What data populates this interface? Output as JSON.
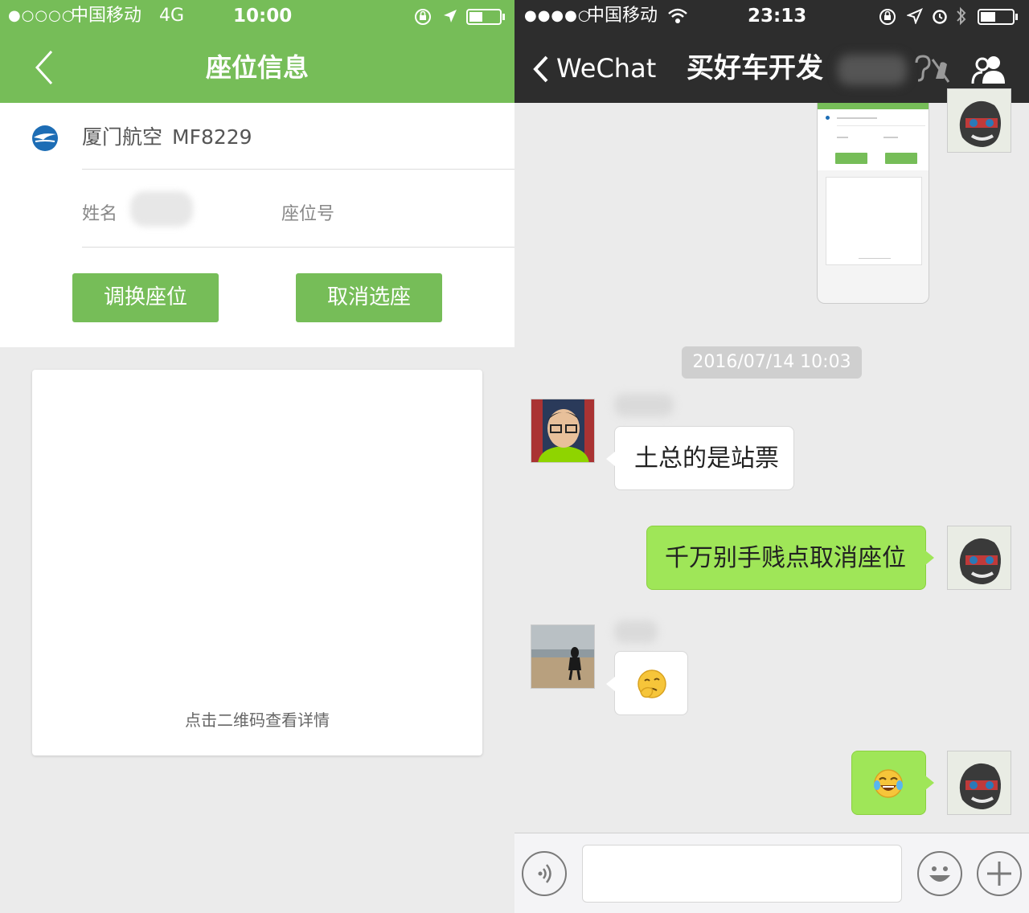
{
  "left": {
    "status": {
      "signal": "●○○○○",
      "carrier": "中国移动",
      "network": "4G",
      "time": "10:00"
    },
    "nav": {
      "title": "座位信息"
    },
    "flight": {
      "airline": "厦门航空",
      "number": "MF8229"
    },
    "labels": {
      "name": "姓名",
      "seat": "座位号"
    },
    "buttons": {
      "change_seat": "调换座位",
      "cancel_seat": "取消选座"
    },
    "qr": {
      "hint": "点击二维码查看详情"
    },
    "colors": {
      "accent": "#76bd58"
    }
  },
  "right": {
    "status": {
      "signal": "●●●●○",
      "carrier": "中国移动",
      "time": "23:13"
    },
    "nav": {
      "back_label": "WeChat",
      "title": "买好车开发"
    },
    "timestamp": "2016/07/14 10:03",
    "messages": [
      {
        "direction": "incoming",
        "text": "土总的是站票"
      },
      {
        "direction": "outgoing",
        "text": "千万别手贱点取消座位"
      },
      {
        "direction": "incoming",
        "emoji": "thinking-face"
      },
      {
        "direction": "outgoing",
        "emoji": "tears-of-joy-face"
      }
    ],
    "icons": [
      "voice-icon",
      "emoji-icon",
      "plus-icon",
      "group-members-icon",
      "mute-icon"
    ],
    "colors": {
      "nav": "#2d2d2d",
      "outgoing_bubble": "#9fe658"
    }
  }
}
